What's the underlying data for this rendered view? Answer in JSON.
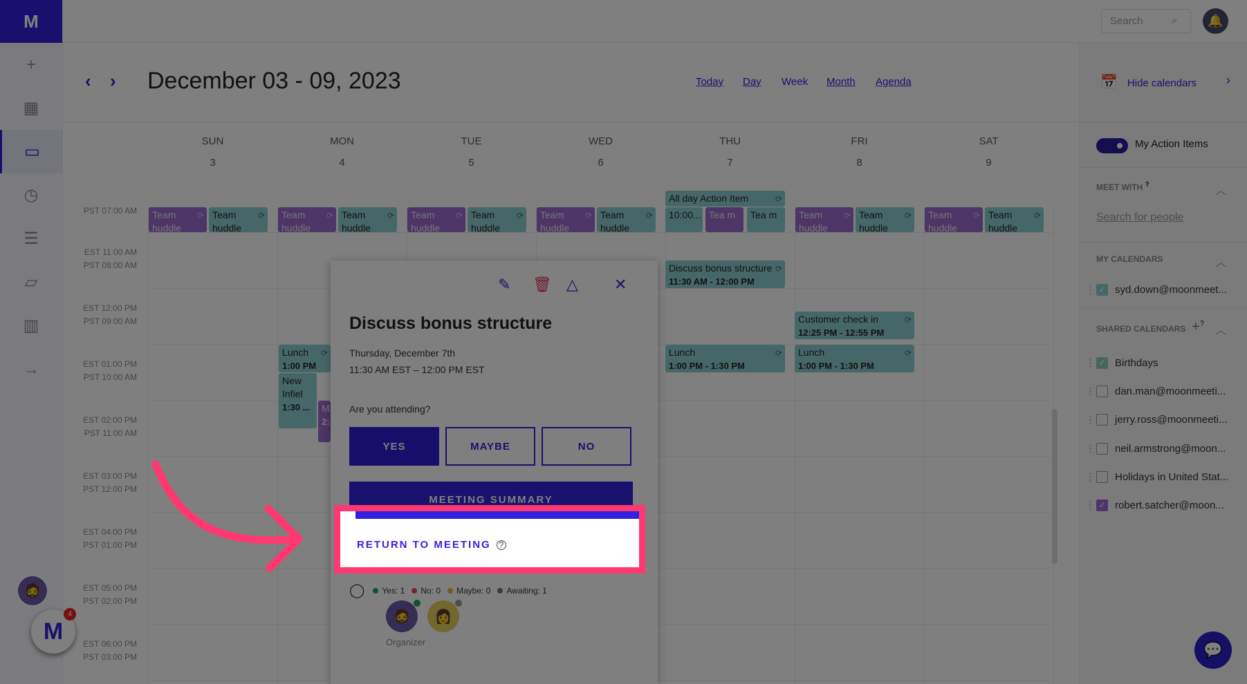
{
  "brand": {
    "logo": "M",
    "accent": "#3020d8",
    "highlight": "#ff3872"
  },
  "sidebar": {
    "items": [
      {
        "name": "add",
        "icon": "+"
      },
      {
        "name": "dashboard",
        "icon": "▦"
      },
      {
        "name": "calendar",
        "icon": "▭",
        "active": true
      },
      {
        "name": "history",
        "icon": "◷"
      },
      {
        "name": "notes",
        "icon": "☰"
      },
      {
        "name": "archive",
        "icon": "▱"
      },
      {
        "name": "analytics",
        "icon": "▥"
      },
      {
        "name": "logout",
        "icon": "→"
      }
    ],
    "fab_badge": "4"
  },
  "topbar": {
    "search_placeholder": "Search"
  },
  "header": {
    "prev": "‹",
    "next": "›",
    "range": "December 03 - 09, 2023",
    "views": [
      {
        "label": "Today"
      },
      {
        "label": "Day"
      },
      {
        "label": "Week",
        "current": true
      },
      {
        "label": "Month"
      },
      {
        "label": "Agenda"
      }
    ]
  },
  "days": [
    {
      "name": "SUN",
      "date": "3"
    },
    {
      "name": "MON",
      "date": "4"
    },
    {
      "name": "TUE",
      "date": "5"
    },
    {
      "name": "WED",
      "date": "6"
    },
    {
      "name": "THU",
      "date": "7"
    },
    {
      "name": "FRI",
      "date": "8"
    },
    {
      "name": "SAT",
      "date": "9"
    }
  ],
  "times": [
    {
      "est": "",
      "pst": "PST 07:00 AM"
    },
    {
      "est": "EST 11:00 AM",
      "pst": "PST 08:00 AM"
    },
    {
      "est": "EST 12:00 PM",
      "pst": "PST 09:00 AM"
    },
    {
      "est": "EST 01:00 PM",
      "pst": "PST 10:00 AM"
    },
    {
      "est": "EST 02:00 PM",
      "pst": "PST 11:00 AM"
    },
    {
      "est": "EST 03:00 PM",
      "pst": "PST 12:00 PM"
    },
    {
      "est": "EST 04:00 PM",
      "pst": "PST 01:00 PM"
    },
    {
      "est": "EST 05:00 PM",
      "pst": "PST 02:00 PM"
    },
    {
      "est": "EST 06:00 PM",
      "pst": "PST 03:00 PM"
    }
  ],
  "events": [
    {
      "title": "Team huddle",
      "time": "",
      "color": "purple"
    },
    {
      "title": "Team huddle",
      "time": "",
      "color": "teal"
    },
    {
      "title": "Team huddle",
      "time": "",
      "color": "purple"
    },
    {
      "title": "Team huddle",
      "time": "",
      "color": "teal"
    },
    {
      "title": "Team huddle",
      "time": "",
      "color": "purple"
    },
    {
      "title": "Team huddle",
      "time": "",
      "color": "teal"
    },
    {
      "title": "Team huddle",
      "time": "",
      "color": "purple"
    },
    {
      "title": "Team huddle",
      "time": "",
      "color": "teal"
    },
    {
      "title": "10:00...",
      "time": "",
      "color": "teal"
    },
    {
      "title": "Tea m",
      "time": "",
      "color": "purple"
    },
    {
      "title": "Tea m",
      "time": "",
      "color": "teal"
    },
    {
      "title": "Team huddle",
      "time": "",
      "color": "purple"
    },
    {
      "title": "Team huddle",
      "time": "",
      "color": "teal"
    },
    {
      "title": "Team huddle",
      "time": "",
      "color": "purple"
    },
    {
      "title": "Team huddle",
      "time": "",
      "color": "teal"
    },
    {
      "title": "All day Action Item",
      "time": "",
      "color": "teal"
    },
    {
      "title": "Discuss bonus structure",
      "time": "11:30 AM - 12:00 PM",
      "color": "teal"
    },
    {
      "title": "Customer check in",
      "time": "12:25 PM - 12:55 PM",
      "color": "teal"
    },
    {
      "title": "Lunch",
      "time": "1:00 PM",
      "color": "teal"
    },
    {
      "title": "Lunch",
      "time": "1:00 PM - 1:30 PM",
      "color": "teal"
    },
    {
      "title": "Lunch",
      "time": "1:00 PM - 1:30 PM",
      "color": "teal"
    },
    {
      "title": "New Infiel",
      "time": "1:30 ...",
      "color": "teal"
    },
    {
      "title": "M",
      "time": "2:",
      "color": "purple"
    }
  ],
  "right_panel": {
    "hide_calendars": "Hide calendars",
    "action_items": "My Action Items",
    "action_items_on": true,
    "meet_with": "MEET WITH",
    "help": "?",
    "search_people": "Search for people",
    "my_calendars": "MY CALENDARS",
    "shared_calendars": "SHARED CALENDARS",
    "add": "+",
    "calendars": [
      {
        "label": "syd.down@moonmeet...",
        "checked": true,
        "color": "#8dcfd0"
      },
      {
        "label": "Birthdays",
        "checked": true,
        "color": "#8fd0b0"
      },
      {
        "label": "dan.man@moonmeeti...",
        "checked": false
      },
      {
        "label": "jerry.ross@moonmeeti...",
        "checked": false
      },
      {
        "label": "neil.armstrong@moon...",
        "checked": false
      },
      {
        "label": "Holidays in United Stat...",
        "checked": false
      },
      {
        "label": "robert.satcher@moon...",
        "checked": true,
        "color": "#9a6bcf"
      }
    ]
  },
  "modal": {
    "title": "Discuss bonus structure",
    "date": "Thursday, December 7th",
    "time": "11:30 AM EST – 12:00 PM EST",
    "question": "Are you attending?",
    "yes": "YES",
    "maybe": "MAYBE",
    "no": "NO",
    "selected": "YES",
    "summary": "MEETING SUMMARY",
    "return": "RETURN TO MEETING",
    "help": "?",
    "stats": [
      {
        "label": "Yes: 1",
        "color": "#1fa463"
      },
      {
        "label": "No: 0",
        "color": "#e0505a"
      },
      {
        "label": "Maybe: 0",
        "color": "#e5b830"
      },
      {
        "label": "Awaiting: 1",
        "color": "#777"
      }
    ],
    "organizer": "Organizer"
  }
}
